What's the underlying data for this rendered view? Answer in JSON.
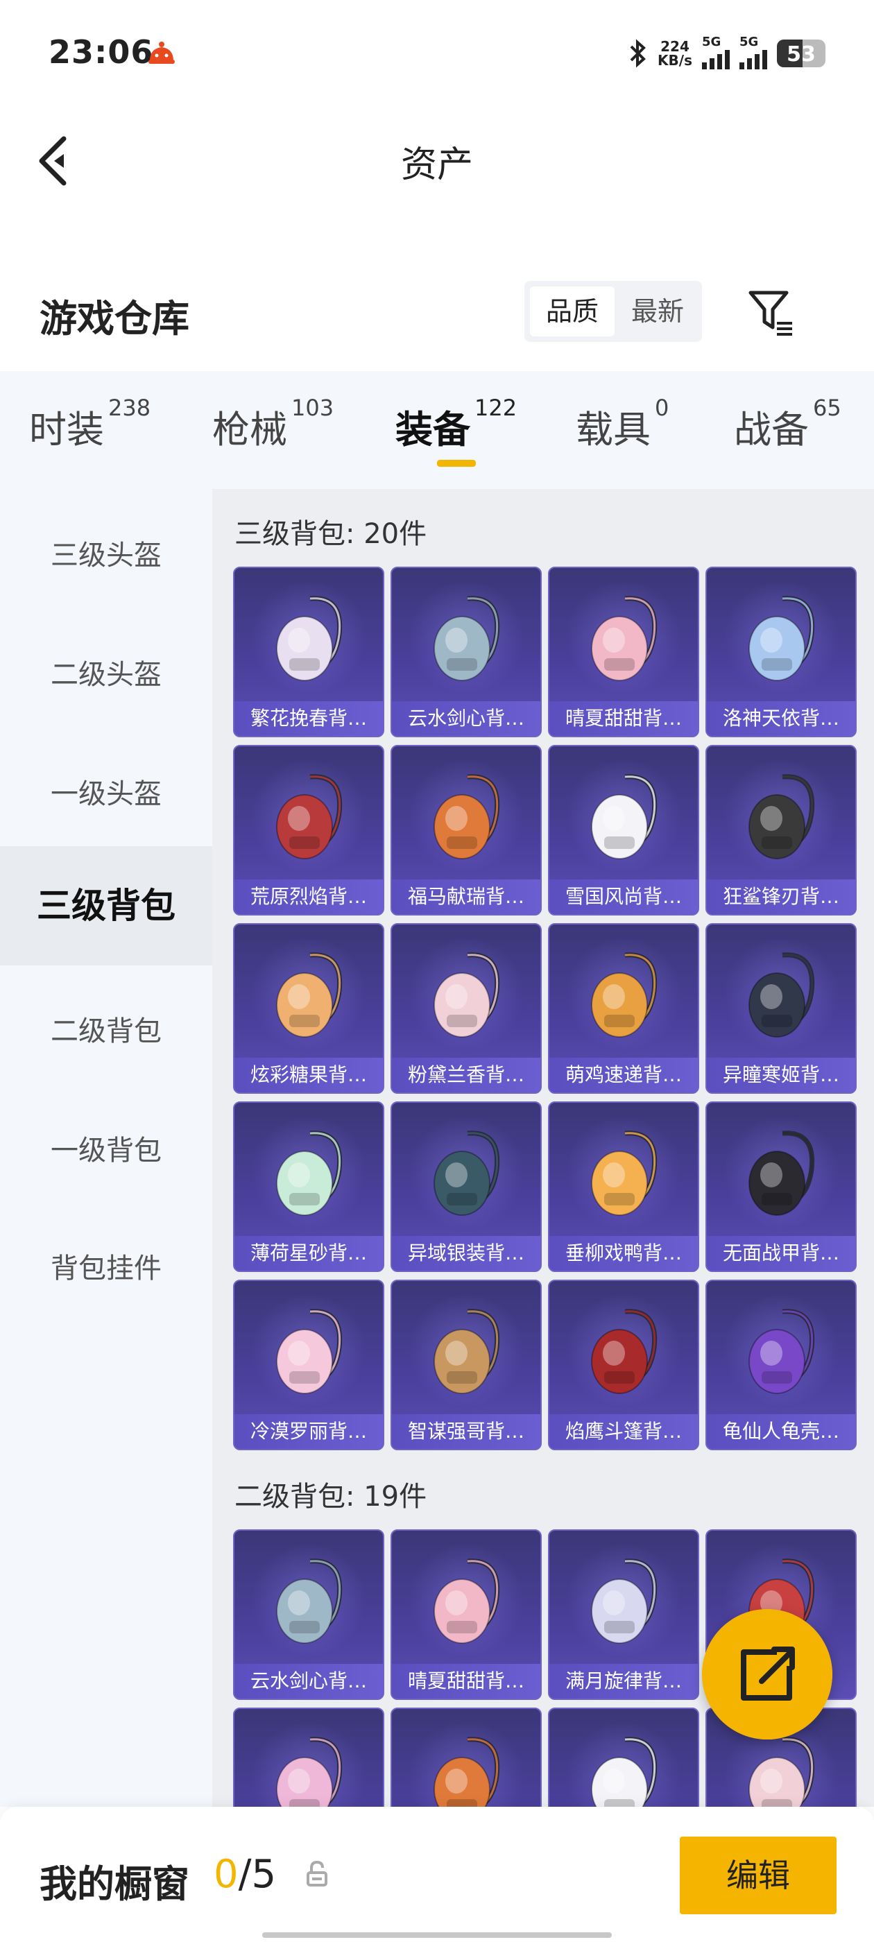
{
  "status_bar": {
    "time": "23:06",
    "net_speed_value": "224",
    "net_speed_unit": "KB/s",
    "signal1_label": "5G",
    "signal2_label": "5G",
    "battery_level": "53",
    "icons": [
      "bluetooth-icon",
      "notification-icon"
    ]
  },
  "header": {
    "title": "资产",
    "back_icon": "chevron-left-icon"
  },
  "warehouse": {
    "title": "游戏仓库",
    "sort_options": [
      "品质",
      "最新"
    ],
    "sort_selected": "品质",
    "filter_icon": "filter-icon"
  },
  "tabs": [
    {
      "label": "时装",
      "count": "238"
    },
    {
      "label": "枪械",
      "count": "103"
    },
    {
      "label": "装备",
      "count": "122"
    },
    {
      "label": "载具",
      "count": "0"
    },
    {
      "label": "战备",
      "count": "65"
    }
  ],
  "active_tab": "装备",
  "sidebar": {
    "items": [
      "三级头盔",
      "二级头盔",
      "一级头盔",
      "三级背包",
      "二级背包",
      "一级背包",
      "背包挂件"
    ],
    "active": "三级背包"
  },
  "sections": [
    {
      "title": "三级背包: 20件",
      "items": [
        "繁花挽春背…",
        "云水剑心背…",
        "晴夏甜甜背…",
        "洛神天依背…",
        "荒原烈焰背…",
        "福马献瑞背…",
        "雪国风尚背…",
        "狂鲨锋刃背…",
        "炫彩糖果背…",
        "粉黛兰香背…",
        "萌鸡速递背…",
        "异瞳寒姬背…",
        "薄荷星砂背…",
        "异域银装背…",
        "垂柳戏鸭背…",
        "无面战甲背…",
        "冷漠罗丽背…",
        "智谋强哥背…",
        "焰鹰斗篷背…",
        "龟仙人龟壳…"
      ]
    },
    {
      "title": "二级背包: 19件",
      "items": [
        "云水剑心背…",
        "晴夏甜甜背…",
        "满月旋律背…",
        "",
        "",
        "",
        "",
        ""
      ]
    }
  ],
  "item_colors": {
    "s0": [
      "#e8e0f0",
      "#9fb8c8",
      "#f2b8c8",
      "#a8c8f0",
      "#b83a3a",
      "#e07a3a",
      "#f4f4f8",
      "#3a3a3a",
      "#f0b070",
      "#f2d0d8",
      "#e8a040",
      "#30384a",
      "#c8ecd8",
      "#3a5a68",
      "#f5b050",
      "#2a2a30",
      "#f6c8dc",
      "#c89860",
      "#a82a2a",
      "#7848c8"
    ],
    "s1": [
      "#9fb8c8",
      "#f2b8c8",
      "#d8d8f0",
      "#c84040",
      "#f0b8d8",
      "#e07a3a",
      "#f4f4f8",
      "#f2d0d8"
    ]
  },
  "fab": {
    "icon": "share-icon"
  },
  "bottom_bar": {
    "title": "我的橱窗",
    "count_current": "0",
    "count_total": "/5",
    "lock_icon": "lock-icon",
    "edit_label": "编辑"
  },
  "colors": {
    "accent": "#f5b400",
    "card_bg": "#4a3f9a"
  }
}
